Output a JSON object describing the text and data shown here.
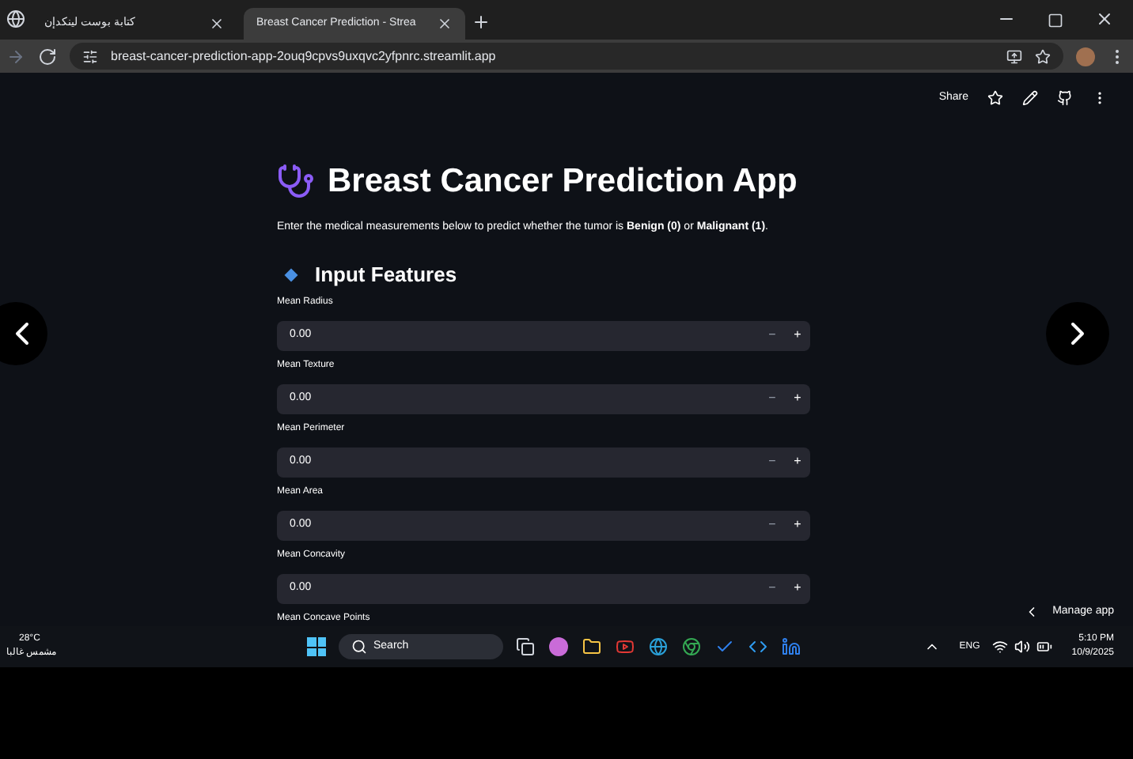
{
  "browser": {
    "tabs": [
      {
        "title": "كتابة بوست لينكدإن",
        "selected": false
      },
      {
        "title": "Breast Cancer Prediction - Strea",
        "selected": true
      }
    ],
    "url": "breast-cancer-prediction-app-2ouq9cpvs9uxqvc2yfpnrc.streamlit.app"
  },
  "toolbar": {
    "share": "Share"
  },
  "app": {
    "title": "Breast Cancer Prediction App",
    "description": "Enter the medical measurements below to predict whether the tumor is **Benign (0)** or **Malignant (1)**.",
    "section": "Input Features",
    "fields": [
      {
        "label": "Mean Radius",
        "value": "0.00"
      },
      {
        "label": "Mean Texture",
        "value": "0.00"
      },
      {
        "label": "Mean Perimeter",
        "value": "0.00"
      },
      {
        "label": "Mean Area",
        "value": "0.00"
      },
      {
        "label": "Mean Concavity",
        "value": "0.00"
      },
      {
        "label": "Mean Concave Points"
      }
    ],
    "minus": "−",
    "plus": "+",
    "manage": "Manage app"
  },
  "taskbar": {
    "weather_temp": "28°C",
    "weather_text": "مشمس غالبا",
    "search": "Search",
    "language": "ENG",
    "time": "5:10 PM",
    "date": "10/9/2025"
  }
}
